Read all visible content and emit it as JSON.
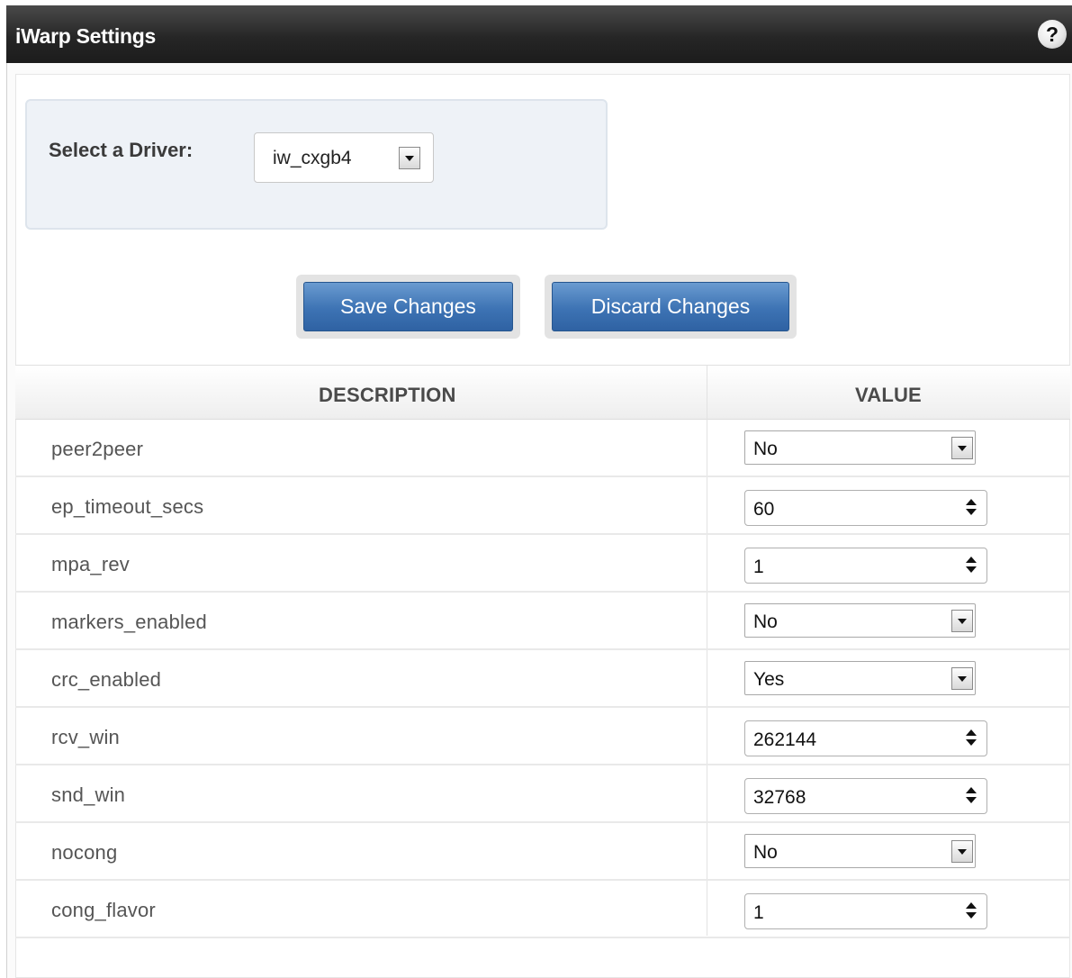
{
  "window": {
    "title": "iWarp Settings",
    "help_glyph": "?"
  },
  "driver": {
    "label": "Select a Driver:",
    "selected": "iw_cxgb4"
  },
  "actions": {
    "save_label": "Save Changes",
    "discard_label": "Discard Changes"
  },
  "table": {
    "headers": {
      "description": "DESCRIPTION",
      "value": "VALUE"
    },
    "rows": [
      {
        "description": "peer2peer",
        "value": "No",
        "control": "select"
      },
      {
        "description": "ep_timeout_secs",
        "value": "60",
        "control": "spinner"
      },
      {
        "description": "mpa_rev",
        "value": "1",
        "control": "spinner"
      },
      {
        "description": "markers_enabled",
        "value": "No",
        "control": "select"
      },
      {
        "description": "crc_enabled",
        "value": "Yes",
        "control": "select"
      },
      {
        "description": "rcv_win",
        "value": "262144",
        "control": "spinner"
      },
      {
        "description": "snd_win",
        "value": "32768",
        "control": "spinner"
      },
      {
        "description": "nocong",
        "value": "No",
        "control": "select"
      },
      {
        "description": "cong_flavor",
        "value": "1",
        "control": "spinner"
      }
    ]
  },
  "icons": {
    "help": "help-icon",
    "dropdown": "chevron-down-icon",
    "spinner": "spinner-arrows-icon"
  },
  "colors": {
    "title_bar": "#262626",
    "button_blue": "#3d73b4",
    "driver_panel": "#eef2f7"
  }
}
